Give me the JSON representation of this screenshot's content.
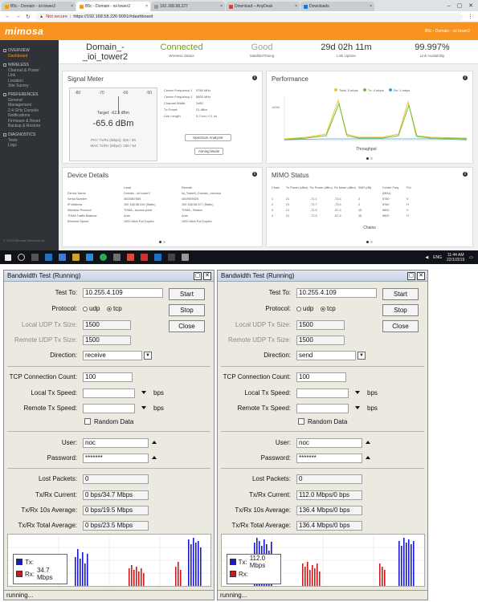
{
  "browser": {
    "tabs": [
      "B5c - Domain - ioi tower2",
      "B5c - Domain - ioi tower2",
      "192.168.58.227",
      "Download – AnyDesk",
      "Downloads"
    ],
    "not_secure": "Not secure",
    "url": "https://192.168.58.226:9091/#dashboard"
  },
  "mimosa": {
    "logo": "mimosa",
    "user": "B5c - Domain - ioi tower2",
    "sidebar": [
      {
        "section": "OVERVIEW",
        "items": [
          "Dashboard"
        ]
      },
      {
        "section": "WIRELESS",
        "items": [
          "Channel & Power",
          "Link",
          "Location",
          "Site Survey"
        ]
      },
      {
        "section": "PREFERENCES",
        "items": [
          "General",
          "Management",
          "2.4 GHz Console",
          "Notifications",
          "Firmware & Reset",
          "Backup & Restore"
        ]
      },
      {
        "section": "DIAGNOSTICS",
        "items": [
          "Tests",
          "Logs"
        ]
      }
    ],
    "sidebar_footer": "© 2018 Mimosa Networks Inc.",
    "summary": {
      "link_name": {
        "value": "Domain_-_ioi_tower2",
        "label": "Link Name"
      },
      "wireless": {
        "value": "Connected",
        "label": "Wireless Status"
      },
      "satellite": {
        "value": "Good",
        "label": "Satellite/Timing"
      },
      "uptime": {
        "value": "29d 02h 11m",
        "label": "Link Uptime"
      },
      "availability": {
        "value": "99.997%",
        "label": "Link Availability"
      }
    },
    "signal_meter": {
      "title": "Signal Meter",
      "scale": [
        "-80",
        "-70",
        "-60",
        "-50"
      ],
      "target": "Target: -62.3 dBm",
      "value": "-65.6 dBm",
      "phy": "PHY Tx/Rx (Mbps): 260 / 90",
      "mac": "MAC Tx/Rx (Mbps): 156 / 54",
      "info": [
        [
          "Center Frequency 1",
          "5780 MHz"
        ],
        [
          "Center Frequency 2",
          "5800 MHz"
        ],
        [
          "Channel Width",
          "2x80"
        ],
        [
          "Tx Power",
          "21 dBm"
        ],
        [
          "Link Length",
          "0.2 km / 0.1 mi"
        ]
      ],
      "spectrum_button": "Spectrum Analyzer",
      "aiming_button": "Aiming Mode"
    },
    "performance": {
      "title": "Performance",
      "legend": [
        "Total: 5 mbps",
        "Tx: 4 mbps",
        "Rx: 1 mbps"
      ],
      "caption": "Throughput",
      "ylabel": "150M"
    },
    "device_details": {
      "title": "Device Details",
      "header": [
        "",
        "Local",
        "Remote"
      ],
      "rows": [
        [
          "Device Name",
          "Domain - ioi tower2",
          "ioi_Tower2_Domain_mimosa"
        ],
        [
          "Serial Number",
          "4003887559",
          "4003909425"
        ],
        [
          "IP Address",
          "192.168.58.226 (Static)",
          "192.168.58.227 (Static)"
        ],
        [
          "Wireless Protocol",
          "TDMA - Access point",
          "TDMA - Station"
        ],
        [
          "TDMA Traffic Balance",
          "Auto",
          "Auto"
        ],
        [
          "Ethernet Speed",
          "1000 Mb/s Full Duplex",
          "1000 Mb/s Full Duplex"
        ]
      ]
    },
    "mimo": {
      "title": "MIMO Status",
      "header": [
        "Chain",
        "Tx Power (dBm)",
        "Rx Power (dBm)",
        "Rx Noise (dBm)",
        "SNR (dB)",
        "Center Freq (MHz)",
        "Pol"
      ],
      "rows": [
        [
          "1",
          "21",
          "-71.1",
          "-73.4",
          "2",
          "5780",
          "V"
        ],
        [
          "2",
          "21",
          "-71.7",
          "-73.4",
          "2",
          "5780",
          "H"
        ],
        [
          "3",
          "21",
          "-71.5",
          "-87.4",
          "15",
          "5800",
          "V"
        ],
        [
          "4",
          "21",
          "-72.5",
          "-87.4",
          "15",
          "5800",
          "H"
        ]
      ],
      "caption": "Chains"
    }
  },
  "taskbar": {
    "lang": "ENG",
    "time": "11:44 AM",
    "date": "22/1/2019"
  },
  "bw_left": {
    "title": "Bandwidth Test (Running)",
    "test_to_label": "Test To:",
    "test_to": "10.255.4.109",
    "protocol_label": "Protocol:",
    "udp": "udp",
    "tcp": "tcp",
    "local_udp_label": "Local UDP Tx Size:",
    "local_udp": "1500",
    "remote_udp_label": "Remote UDP Tx Size:",
    "remote_udp": "1500",
    "direction_label": "Direction:",
    "direction": "receive",
    "tcp_count_label": "TCP Connection Count:",
    "tcp_count": "100",
    "local_speed_label": "Local Tx Speed:",
    "remote_speed_label": "Remote Tx Speed:",
    "bps": "bps",
    "random_label": "Random Data",
    "user_label": "User:",
    "user": "noc",
    "password_label": "Password:",
    "password": "*******",
    "lost_label": "Lost Packets:",
    "lost": "0",
    "current_label": "Tx/Rx Current:",
    "current": "0 bps/34.7 Mbps",
    "avg10_label": "Tx/Rx 10s Average:",
    "avg10": "0 bps/19.5 Mbps",
    "total_label": "Tx/Rx Total Average:",
    "total": "0 bps/23.5 Mbps",
    "start": "Start",
    "stop": "Stop",
    "close": "Close",
    "legend_tx": "Tx:",
    "legend_tx_val": "",
    "legend_rx": "Rx:",
    "legend_rx_val": "34.7 Mbps",
    "status": "running..."
  },
  "bw_right": {
    "title": "Bandwidth Test (Running)",
    "test_to_label": "Test To:",
    "test_to": "10.255.4.109",
    "protocol_label": "Protocol:",
    "udp": "udp",
    "tcp": "tcp",
    "local_udp_label": "Local UDP Tx Size:",
    "local_udp": "1500",
    "remote_udp_label": "Remote UDP Tx Size:",
    "remote_udp": "1500",
    "direction_label": "Direction:",
    "direction": "send",
    "tcp_count_label": "TCP Connection Count:",
    "tcp_count": "100",
    "local_speed_label": "Local Tx Speed:",
    "remote_speed_label": "Remote Tx Speed:",
    "bps": "bps",
    "random_label": "Random Data",
    "user_label": "User:",
    "user": "noc",
    "password_label": "Password:",
    "password": "*******",
    "lost_label": "Lost Packets:",
    "lost": "0",
    "current_label": "Tx/Rx Current:",
    "current": "112.0 Mbps/0 bps",
    "avg10_label": "Tx/Rx 10s Average:",
    "avg10": "136.4 Mbps/0 bps",
    "total_label": "Tx/Rx Total Average:",
    "total": "136.4 Mbps/0 bps",
    "start": "Start",
    "stop": "Stop",
    "close": "Close",
    "legend_tx": "Tx:",
    "legend_tx_val": "112.0 Mbps",
    "legend_rx": "Rx:",
    "legend_rx_val": "",
    "status": "running..."
  },
  "colors": {
    "accent": "#f7931e",
    "tx": "#1a1acc",
    "rx": "#cc1a1a"
  }
}
